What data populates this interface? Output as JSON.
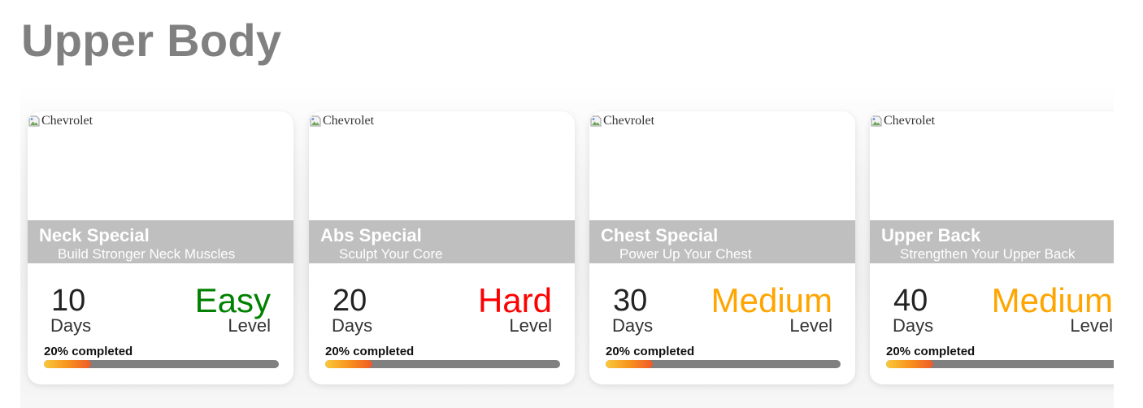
{
  "page": {
    "title": "Upper Body"
  },
  "colors": {
    "easy": "#008000",
    "hard": "#ff0000",
    "medium": "#ffa500",
    "banner_bg": "#bfbfbf",
    "progress_track": "#808080"
  },
  "icons": {
    "broken_image": "broken-image-icon"
  },
  "cards": [
    {
      "image_alt": "Chevrolet",
      "title": "Neck Special",
      "subtitle": "Build Stronger Neck Muscles",
      "days": "10",
      "days_label": "Days",
      "level": "Easy",
      "level_color": "#008000",
      "level_label": "Level",
      "progress_text": "20% completed",
      "progress": 0.2
    },
    {
      "image_alt": "Chevrolet",
      "title": "Abs Special",
      "subtitle": "Sculpt Your Core",
      "days": "20",
      "days_label": "Days",
      "level": "Hard",
      "level_color": "#ff0000",
      "level_label": "Level",
      "progress_text": "20% completed",
      "progress": 0.2
    },
    {
      "image_alt": "Chevrolet",
      "title": "Chest Special",
      "subtitle": "Power Up Your Chest",
      "days": "30",
      "days_label": "Days",
      "level": "Medium",
      "level_color": "#ffa500",
      "level_label": "Level",
      "progress_text": "20% completed",
      "progress": 0.2
    },
    {
      "image_alt": "Chevrolet",
      "title": "Upper Back",
      "subtitle": "Strengthen Your Upper Back",
      "days": "40",
      "days_label": "Days",
      "level": "Medium",
      "level_color": "#ffa500",
      "level_label": "Level",
      "progress_text": "20% completed",
      "progress": 0.2
    }
  ]
}
